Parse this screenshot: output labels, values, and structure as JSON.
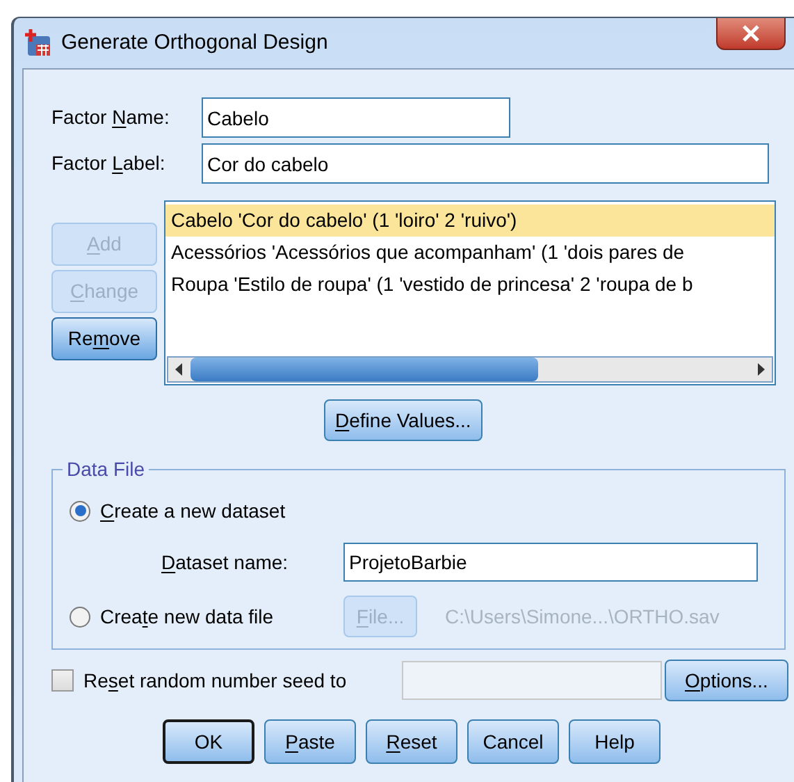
{
  "window": {
    "title": "Generate Orthogonal Design"
  },
  "factor_name": {
    "label": [
      {
        "text": "Factor "
      },
      {
        "text": "N",
        "key": true
      },
      {
        "text": "ame:"
      }
    ],
    "value": "Cabelo"
  },
  "factor_label": {
    "label": [
      {
        "text": "Factor "
      },
      {
        "text": "L",
        "key": true
      },
      {
        "text": "abel:"
      }
    ],
    "value": "Cor do cabelo"
  },
  "factor_buttons": [
    {
      "label": [
        {
          "text": "A",
          "key": true
        },
        {
          "text": "dd"
        }
      ],
      "disabled": true
    },
    {
      "label": [
        {
          "text": "C",
          "key": true
        },
        {
          "text": "hange"
        }
      ],
      "disabled": true
    },
    {
      "label": [
        {
          "text": "Re"
        },
        {
          "text": "m",
          "key": true
        },
        {
          "text": "ove"
        }
      ],
      "disabled": false
    }
  ],
  "factors": [
    {
      "text": "Cabelo 'Cor do cabelo' (1 'loiro' 2 'ruivo')",
      "selected": true
    },
    {
      "text": "Acessórios 'Acessórios que acompanham' (1 'dois pares de",
      "selected": false
    },
    {
      "text": "Roupa 'Estilo de roupa' (1 'vestido de princesa' 2 'roupa de b",
      "selected": false
    }
  ],
  "define_values_button": {
    "label": [
      {
        "text": "D",
        "key": true
      },
      {
        "text": "efine Values..."
      }
    ]
  },
  "data_file": {
    "title": "Data File",
    "options": [
      {
        "label": [
          {
            "text": "C",
            "key": true
          },
          {
            "text": "reate a new dataset"
          }
        ],
        "selected": true
      },
      {
        "label": [
          {
            "text": "Crea"
          },
          {
            "text": "t",
            "key": true
          },
          {
            "text": "e new data file"
          }
        ],
        "selected": false
      }
    ],
    "dataset_name": {
      "label": [
        {
          "text": "D",
          "key": true
        },
        {
          "text": "ataset name:"
        }
      ],
      "value": "ProjetoBarbie"
    },
    "file_button": {
      "label": [
        {
          "text": "F",
          "key": true
        },
        {
          "text": "ile..."
        }
      ],
      "disabled": true
    },
    "path": "C:\\Users\\Simone...\\ORTHO.sav"
  },
  "reset_seed": {
    "label": [
      {
        "text": "Re"
      },
      {
        "text": "s",
        "key": true
      },
      {
        "text": "et random number seed to"
      }
    ],
    "checked": false
  },
  "options_button": {
    "label": [
      {
        "text": "O",
        "key": true
      },
      {
        "text": "ptions..."
      }
    ]
  },
  "buttons": [
    {
      "label": [
        {
          "text": "OK"
        }
      ],
      "default": true
    },
    {
      "label": [
        {
          "text": "P",
          "key": true
        },
        {
          "text": "aste"
        }
      ],
      "default": false
    },
    {
      "label": [
        {
          "text": "R",
          "key": true
        },
        {
          "text": "eset"
        }
      ],
      "default": false
    },
    {
      "label": [
        {
          "text": "Cancel"
        }
      ],
      "default": false
    },
    {
      "label": [
        {
          "text": "Help"
        }
      ],
      "default": false
    }
  ]
}
